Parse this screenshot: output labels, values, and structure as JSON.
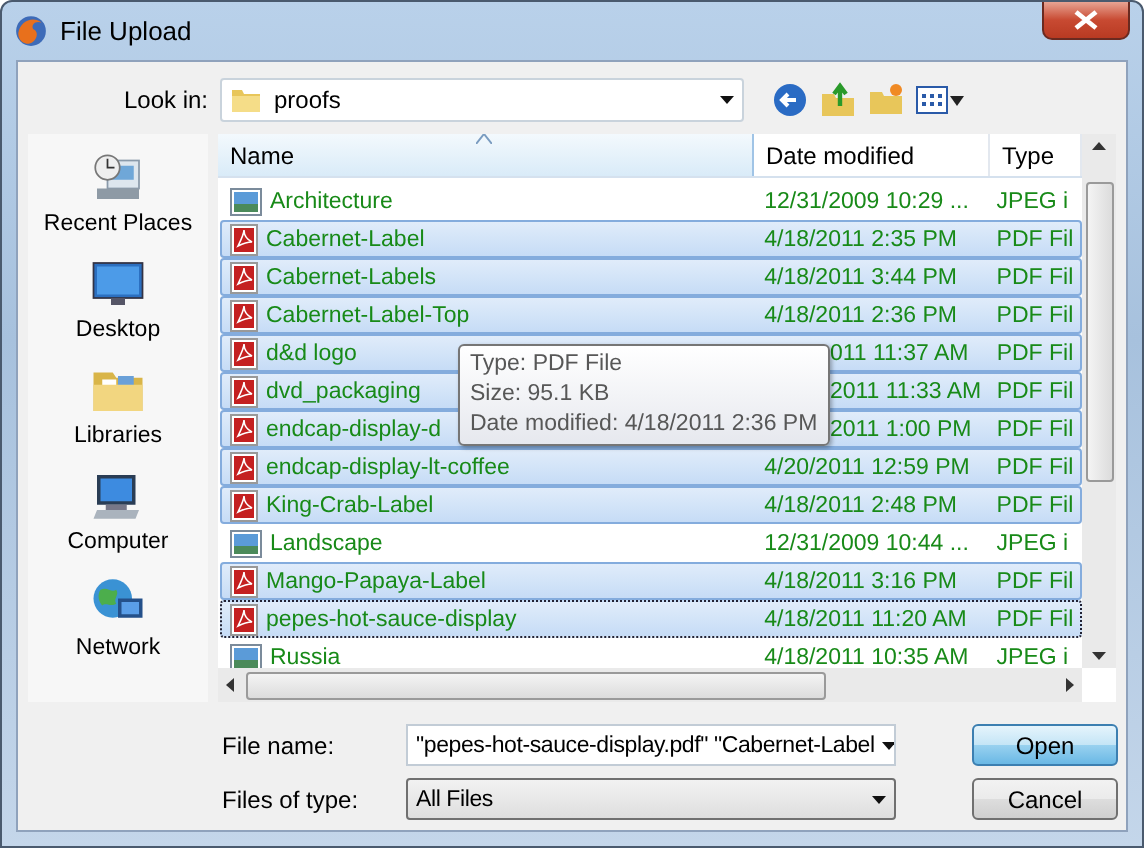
{
  "window": {
    "title": "File Upload"
  },
  "look_in": {
    "label": "Look in:",
    "value": "proofs"
  },
  "places": [
    {
      "label": "Recent Places",
      "kind": "recent"
    },
    {
      "label": "Desktop",
      "kind": "desktop"
    },
    {
      "label": "Libraries",
      "kind": "libraries"
    },
    {
      "label": "Computer",
      "kind": "computer"
    },
    {
      "label": "Network",
      "kind": "network"
    }
  ],
  "table": {
    "columns": [
      "Name",
      "Date modified",
      "Type"
    ],
    "rows": [
      {
        "kind": "image",
        "name": "Architecture",
        "date": "12/31/2009 10:29 ...",
        "type": "JPEG i",
        "selected": false,
        "focused": false,
        "partial": false
      },
      {
        "kind": "pdf",
        "name": "Cabernet-Label",
        "date": "4/18/2011 2:35 PM",
        "type": "PDF Fil",
        "selected": true,
        "focused": false,
        "partial": false
      },
      {
        "kind": "pdf",
        "name": "Cabernet-Labels",
        "date": "4/18/2011 3:44 PM",
        "type": "PDF Fil",
        "selected": true,
        "focused": false,
        "partial": false
      },
      {
        "kind": "pdf",
        "name": "Cabernet-Label-Top",
        "date": "4/18/2011 2:36 PM",
        "type": "PDF Fil",
        "selected": true,
        "focused": false,
        "partial": false
      },
      {
        "kind": "pdf",
        "name": "d&d logo",
        "date": "011 11:37 AM",
        "type": "PDF Fil",
        "selected": true,
        "focused": false,
        "partial": true
      },
      {
        "kind": "pdf",
        "name": "dvd_packaging",
        "date": "2011 11:33 AM",
        "type": "PDF Fil",
        "selected": true,
        "focused": false,
        "partial": true
      },
      {
        "kind": "pdf",
        "name": "endcap-display-d",
        "date": "2011 1:00 PM",
        "type": "PDF Fil",
        "selected": true,
        "focused": false,
        "partial": true
      },
      {
        "kind": "pdf",
        "name": "endcap-display-lt-coffee",
        "date": "4/20/2011 12:59 PM",
        "type": "PDF Fil",
        "selected": true,
        "focused": false,
        "partial": false
      },
      {
        "kind": "pdf",
        "name": "King-Crab-Label",
        "date": "4/18/2011 2:48 PM",
        "type": "PDF Fil",
        "selected": true,
        "focused": false,
        "partial": false
      },
      {
        "kind": "image",
        "name": "Landscape",
        "date": "12/31/2009 10:44 ...",
        "type": "JPEG i",
        "selected": false,
        "focused": false,
        "partial": false
      },
      {
        "kind": "pdf",
        "name": "Mango-Papaya-Label",
        "date": "4/18/2011 3:16 PM",
        "type": "PDF Fil",
        "selected": true,
        "focused": false,
        "partial": false
      },
      {
        "kind": "pdf",
        "name": "pepes-hot-sauce-display",
        "date": "4/18/2011 11:20 AM",
        "type": "PDF Fil",
        "selected": true,
        "focused": true,
        "partial": false
      },
      {
        "kind": "image",
        "name": "Russia",
        "date": "4/18/2011 10:35 AM",
        "type": "JPEG i",
        "selected": false,
        "focused": false,
        "partial": false
      }
    ]
  },
  "tooltip": [
    "Type: PDF File",
    "Size: 95.1 KB",
    "Date modified: 4/18/2011 2:36 PM"
  ],
  "file_name": {
    "label": "File name:",
    "value": "\"pepes-hot-sauce-display.pdf\" \"Cabernet-Label"
  },
  "file_type": {
    "label": "Files of type:",
    "value": "All Files"
  },
  "buttons": [
    "Open",
    "Cancel"
  ]
}
